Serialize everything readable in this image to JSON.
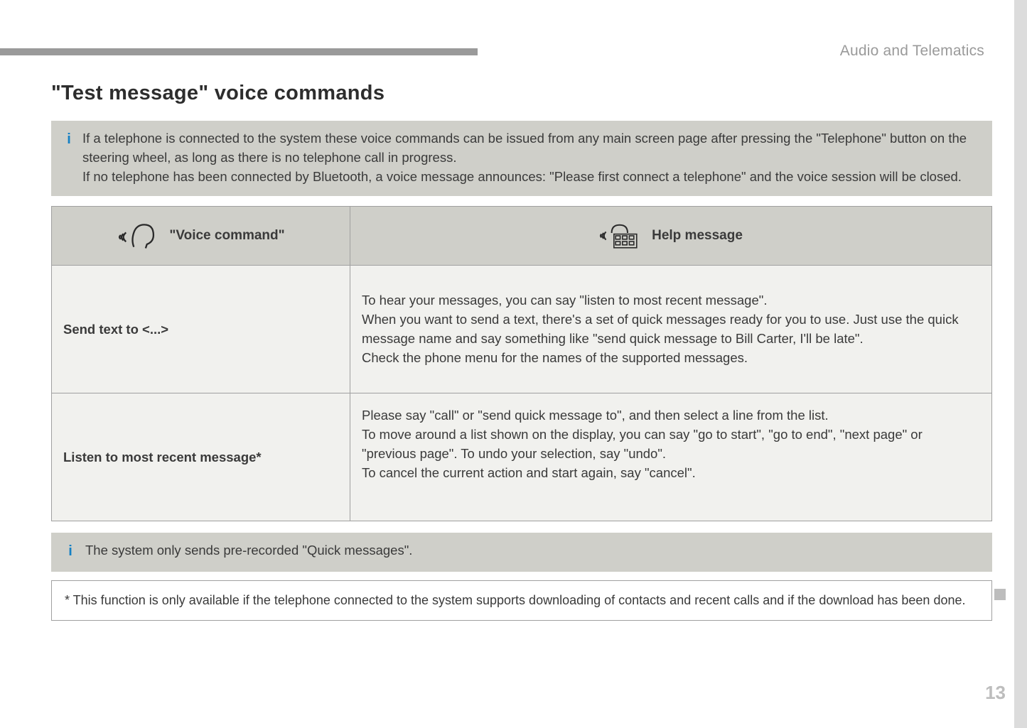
{
  "header": {
    "section": "Audio and Telematics"
  },
  "title": "\"Test message\" voice commands",
  "info1": "If a telephone is connected to the system these voice commands can be issued from any main screen page after pressing the \"Telephone\" button on the steering wheel, as long as there is no telephone call in progress.\nIf no telephone has been connected by Bluetooth, a voice message announces: \"Please first connect a telephone\" and the voice session will be closed.",
  "table": {
    "head": {
      "left": "\"Voice command\"",
      "right": "Help message"
    },
    "rows": [
      {
        "cmd": "Send text to <...>",
        "help": "To hear your messages, you can say \"listen to most recent message\".\nWhen you want to send a text, there's a set of quick messages ready for you to use. Just use the quick message name and say something like \"send quick message to Bill Carter, I'll be late\".\nCheck the phone menu for the names of the supported messages."
      },
      {
        "cmd": "Listen to most recent message*",
        "help": "Please say \"call\" or \"send quick message to\", and then select a line from the list.\nTo move around a list shown on the display, you can say \"go to start\", \"go to end\", \"next page\" or \"previous page\". To undo your selection, say \"undo\".\nTo cancel the current action and start again, say \"cancel\"."
      }
    ]
  },
  "info2": "The system only sends pre-recorded \"Quick messages\".",
  "footnote": "* This function is only available if the telephone connected to the system supports downloading of contacts and recent calls and if the download has been done.",
  "page_number": "13"
}
